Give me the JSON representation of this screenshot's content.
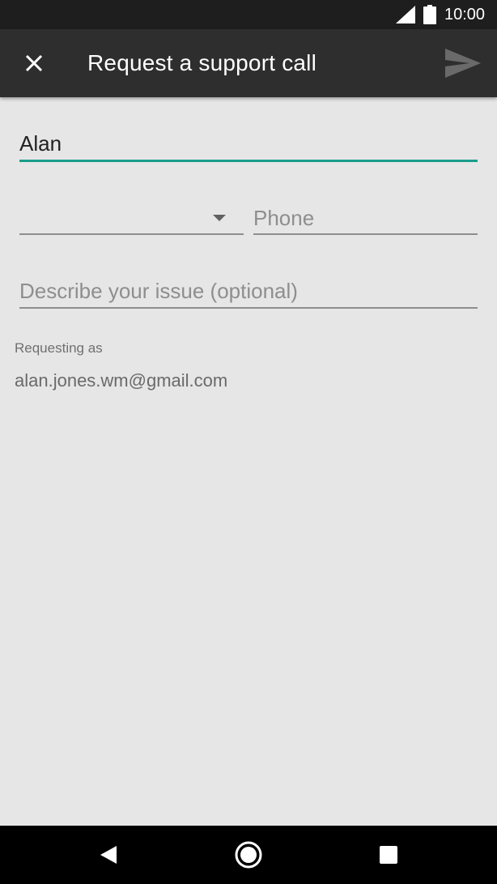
{
  "status_bar": {
    "time": "10:00",
    "icons": [
      "signal-icon",
      "battery-icon"
    ]
  },
  "app_bar": {
    "title": "Request a support call",
    "close_icon": "close-icon",
    "send_icon": "send-icon"
  },
  "form": {
    "name": {
      "value": "Alan",
      "placeholder": ""
    },
    "country_code": {
      "value": ""
    },
    "phone": {
      "value": "",
      "placeholder": "Phone"
    },
    "issue": {
      "value": "",
      "placeholder": "Describe your issue (optional)"
    }
  },
  "requesting": {
    "label": "Requesting as",
    "email": "alan.jones.wm@gmail.com"
  },
  "nav_bar": {
    "icons": [
      "back-icon",
      "home-icon",
      "recents-icon"
    ]
  },
  "colors": {
    "accent": "#1a9d8c",
    "app_bar": "#2e2e2e",
    "status_bar": "#1e1e1e",
    "background": "#e6e6e6"
  }
}
